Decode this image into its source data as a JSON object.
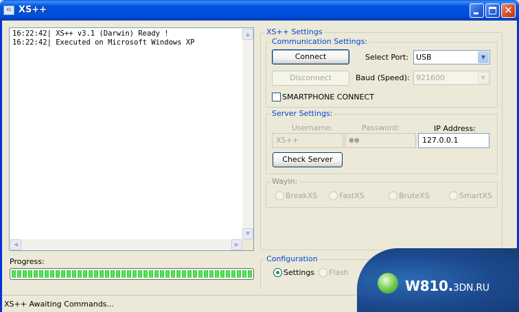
{
  "window": {
    "title": "XS++",
    "icon": "app-icon",
    "icon_text": "XS"
  },
  "log": {
    "lines": [
      "16:22:42| XS++ v3.1 (Darwin) Ready !",
      "16:22:42| Executed on Microsoft Windows XP"
    ]
  },
  "progress": {
    "label": "Progress:",
    "value_percent": 100
  },
  "settings": {
    "title": "XS++ Settings",
    "communication": {
      "title": "Communication Settings:",
      "connect_label": "Connect",
      "disconnect_label": "Disconnect",
      "select_port_label": "Select Port:",
      "port_value": "USB",
      "baud_label": "Baud (Speed):",
      "baud_value": "921600",
      "smartphone_label": "SMARTPHONE CONNECT",
      "smartphone_checked": false
    },
    "server": {
      "title": "Server Settings:",
      "username_label": "Username:",
      "username_value": "XS++",
      "password_label": "Password:",
      "password_value": "●●",
      "ip_label": "IP Address:",
      "ip_value": "127.0.0.1",
      "check_label": "Check Server"
    },
    "wayin": {
      "title": "Wayin:",
      "options": [
        "BreakXS",
        "FastXS",
        "BruteXS",
        "SmartXS"
      ]
    }
  },
  "configuration": {
    "title": "Configuration",
    "options": [
      "Settings",
      "Flash"
    ],
    "selected": "Settings"
  },
  "status": {
    "text": "XS++ Awaiting Commands..."
  },
  "watermark": {
    "main": "W810.",
    "suffix": "3DN.RU"
  }
}
